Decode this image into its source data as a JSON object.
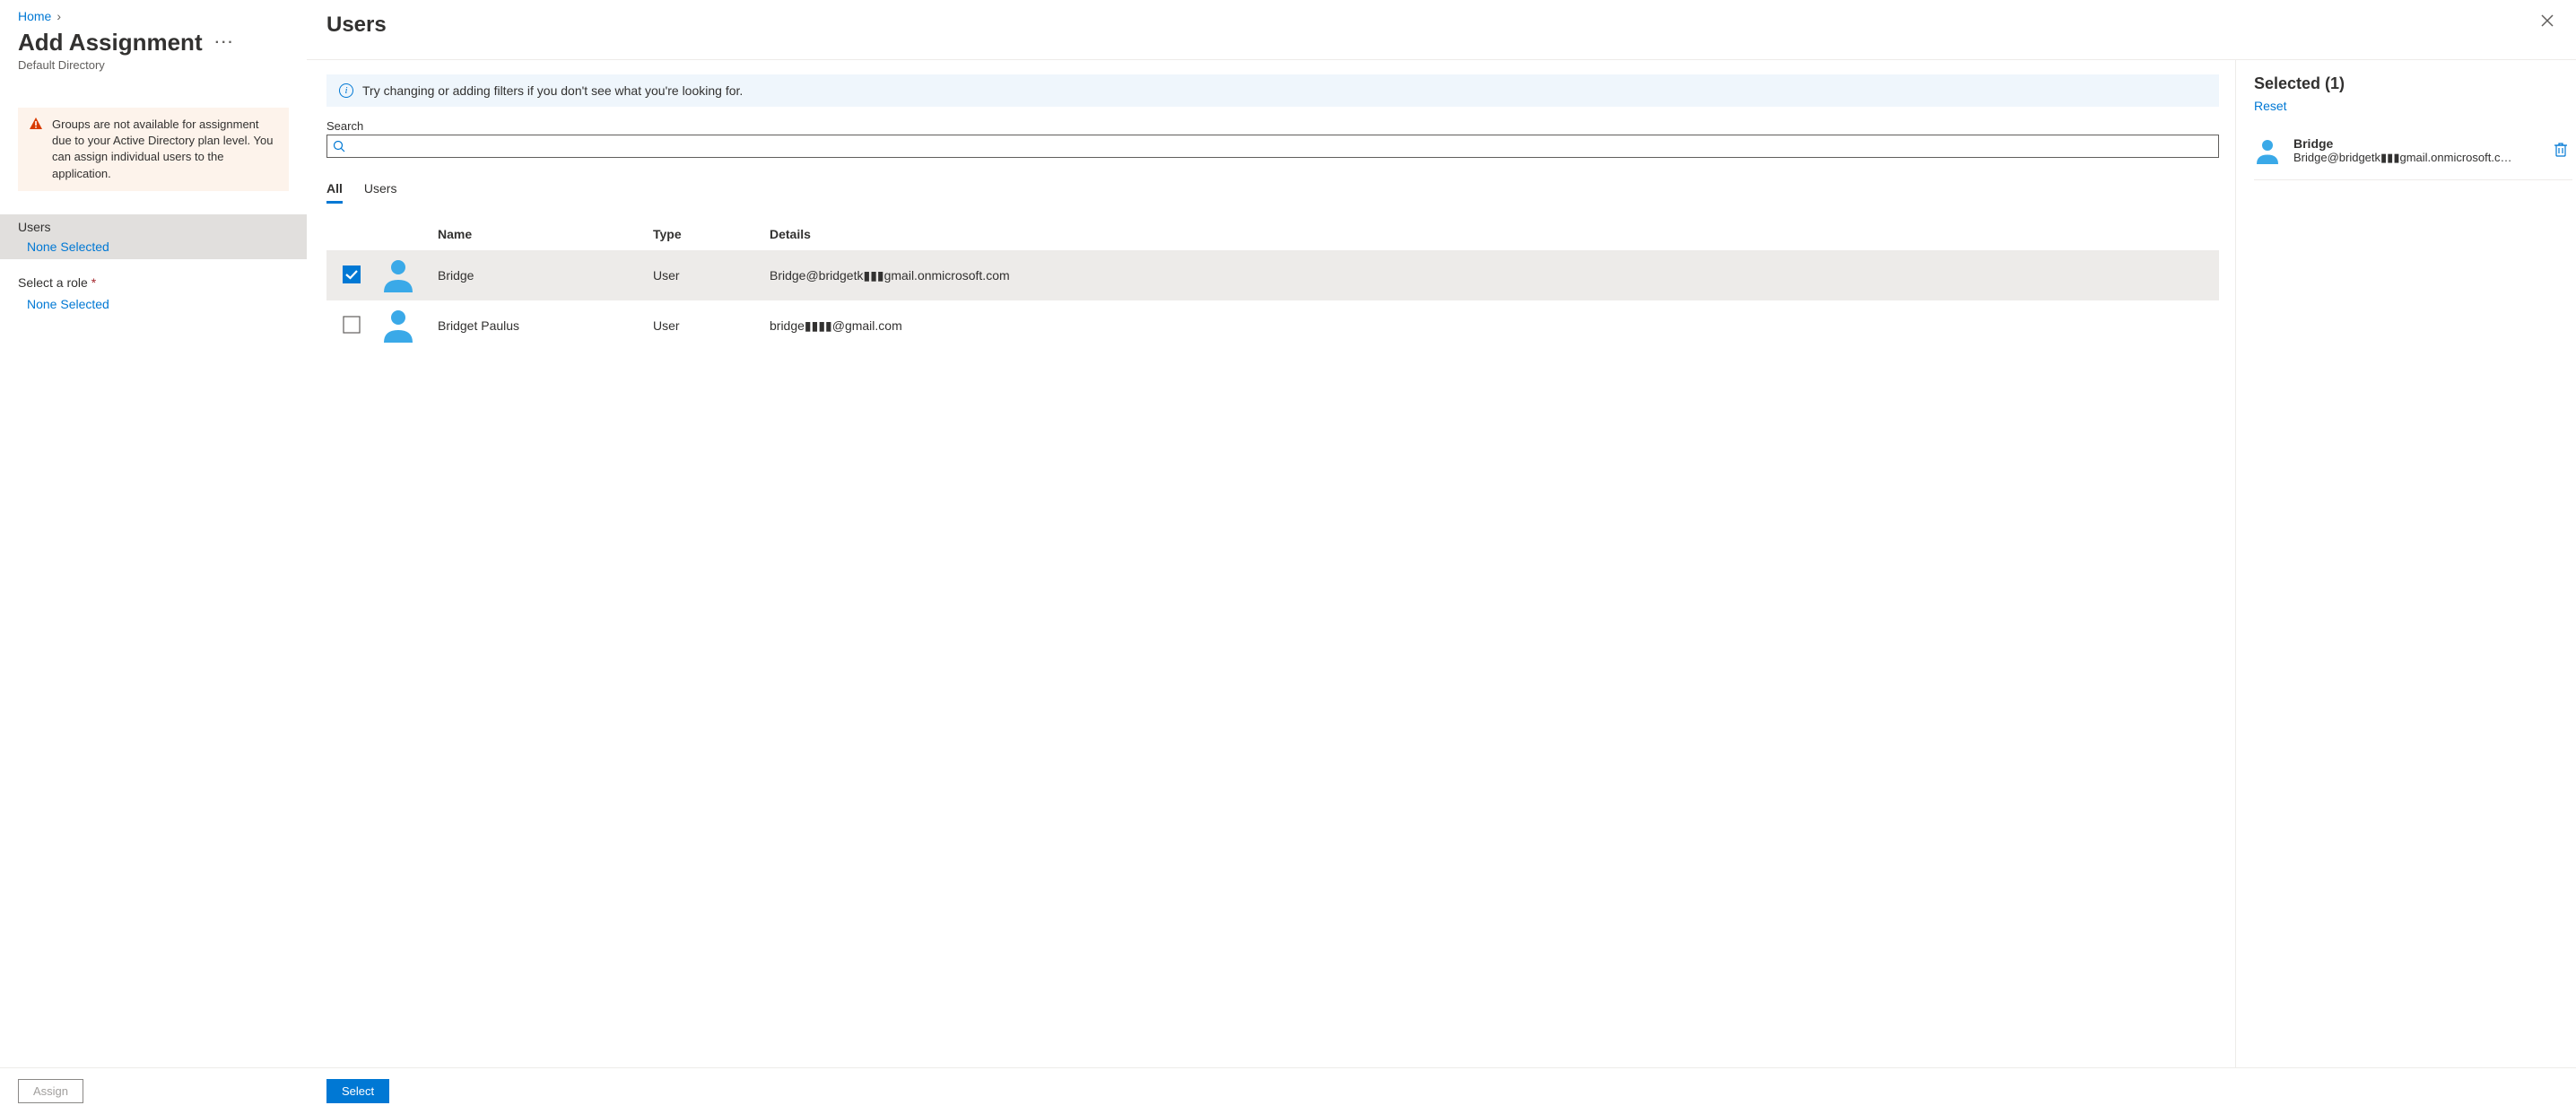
{
  "breadcrumb": {
    "home": "Home"
  },
  "left": {
    "title": "Add Assignment",
    "subtitle": "Default Directory",
    "warning": "Groups are not available for assignment due to your Active Directory plan level. You can assign individual users to the application.",
    "users_label": "Users",
    "users_value": "None Selected",
    "role_label": "Select a role",
    "role_value": "None Selected",
    "assign_button": "Assign"
  },
  "blade": {
    "title": "Users",
    "info": "Try changing or adding filters if you don't see what you're looking for.",
    "search_label": "Search",
    "tabs": {
      "all": "All",
      "users": "Users"
    },
    "columns": {
      "name": "Name",
      "type": "Type",
      "details": "Details"
    },
    "rows": [
      {
        "selected": true,
        "name": "Bridge",
        "type": "User",
        "details": "Bridge@bridgetk▮▮▮gmail.onmicrosoft.com"
      },
      {
        "selected": false,
        "name": "Bridget Paulus",
        "type": "User",
        "details": "bridge▮▮▮▮@gmail.com"
      }
    ],
    "select_button": "Select"
  },
  "selected": {
    "title": "Selected (1)",
    "reset": "Reset",
    "items": [
      {
        "name": "Bridge",
        "email": "Bridge@bridgetk▮▮▮gmail.onmicrosoft.c…"
      }
    ]
  }
}
